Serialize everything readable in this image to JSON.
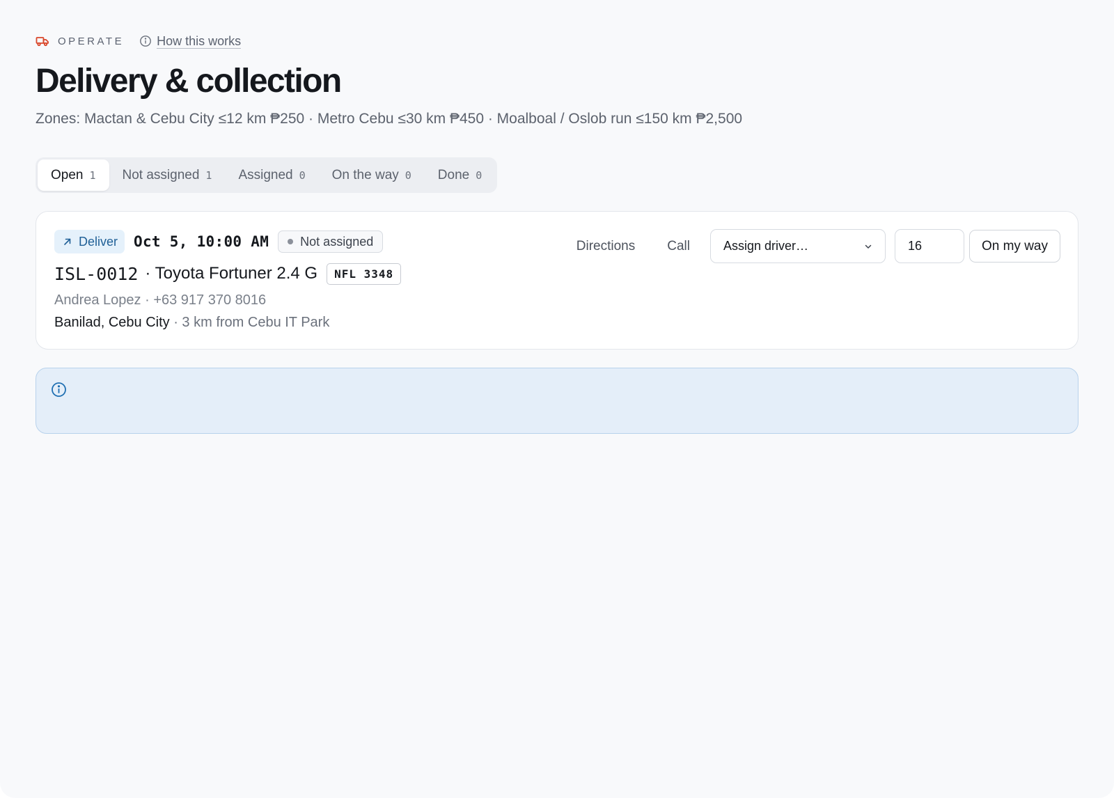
{
  "header": {
    "section_label": "OPERATE",
    "how_link": "How this works",
    "title": "Delivery & collection",
    "zones": "Zones: Mactan & Cebu City ≤12 km ₱250 · Metro Cebu ≤30 km ₱450 · Moalboal / Oslob run ≤150 km ₱2,500"
  },
  "tabs": [
    {
      "label": "Open",
      "count": "1",
      "active": true
    },
    {
      "label": "Not assigned",
      "count": "1",
      "active": false
    },
    {
      "label": "Assigned",
      "count": "0",
      "active": false
    },
    {
      "label": "On the way",
      "count": "0",
      "active": false
    },
    {
      "label": "Done",
      "count": "0",
      "active": false
    }
  ],
  "job": {
    "type": "Deliver",
    "when": "Oct 5, 10:00 AM",
    "status": "Not assigned",
    "reference": "ISL-0012",
    "vehicle": "· Toyota Fortuner 2.4 G",
    "plate": "NFL 3348",
    "contact": "Andrea Lopez · +63 917 370 8016",
    "address": "Banilad, Cebu City",
    "distance": " · 3 km from Cebu IT Park",
    "actions": {
      "directions": "Directions",
      "call": "Call",
      "driver_select": "Assign driver…",
      "eta_value": "16",
      "on_my_way": "On my way"
    }
  },
  "colors": {
    "accent_truck": "#d9472b",
    "deliver_badge_bg": "#e5f1fb",
    "deliver_badge_text": "#1f5f96",
    "info_panel_bg": "#e4eef9",
    "info_icon": "#1f6fb2"
  },
  "icons": {
    "section": "truck-icon",
    "how_link": "info-icon",
    "deliver": "arrow-up-right-icon",
    "select": "chevron-down-icon",
    "info_panel": "info-icon"
  }
}
